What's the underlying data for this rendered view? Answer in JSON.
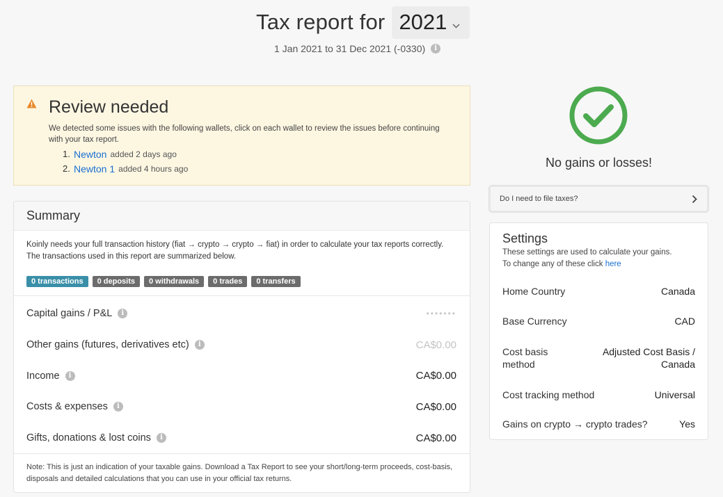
{
  "header": {
    "title_prefix": "Tax report for",
    "year": "2021",
    "date_range": "1 Jan 2021 to 31 Dec 2021 (-0330)"
  },
  "review": {
    "title": "Review needed",
    "description": "We detected some issues with the following wallets, click on each wallet to review the issues before continuing with your tax report.",
    "wallets": [
      {
        "num": "1.",
        "name": "Newton",
        "added": "added 2 days ago"
      },
      {
        "num": "2.",
        "name": "Newton 1",
        "added": "added 4 hours ago"
      }
    ]
  },
  "summary": {
    "title": "Summary",
    "description": "Koinly needs your full transaction history (fiat → crypto → crypto → fiat) in order to calculate your tax reports correctly. The transactions used in this report are summarized below.",
    "badges": [
      "0 transactions",
      "0 deposits",
      "0 withdrawals",
      "0 trades",
      "0 transfers"
    ],
    "rows": [
      {
        "label": "Capital gains / P&L",
        "value": "•••••••"
      },
      {
        "label": "Other gains (futures, derivatives etc)",
        "value": "CA$0.00"
      },
      {
        "label": "Income",
        "value": "CA$0.00"
      },
      {
        "label": "Costs & expenses",
        "value": "CA$0.00"
      },
      {
        "label": "Gifts, donations & lost coins",
        "value": "CA$0.00"
      }
    ],
    "note": "Note: This is just an indication of your taxable gains. Download a Tax Report to see your short/long-term proceeds, cost-basis, disposals and detailed calculations that you can use in your official tax returns."
  },
  "result": {
    "status": "No gains or losses!",
    "file_taxes_label": "Do I need to file taxes?"
  },
  "settings": {
    "title": "Settings",
    "desc_line1": "These settings are used to calculate your gains.",
    "desc_line2": "To change any of these click",
    "link": "here",
    "rows": [
      {
        "label": "Home Country",
        "value": "Canada"
      },
      {
        "label": "Base Currency",
        "value": "CAD"
      },
      {
        "label": "Cost basis method",
        "value": "Adjusted Cost Basis / Canada"
      },
      {
        "label": "Cost tracking method",
        "value": "Universal"
      },
      {
        "label": "Gains on crypto → crypto trades?",
        "value": "Yes"
      }
    ]
  },
  "colors": {
    "accent_green": "#4caa4f",
    "link_blue": "#1a6fd1",
    "warning_orange": "#e8892c",
    "badge_teal": "#3a8fa8",
    "badge_gray": "#6c6c6c"
  }
}
